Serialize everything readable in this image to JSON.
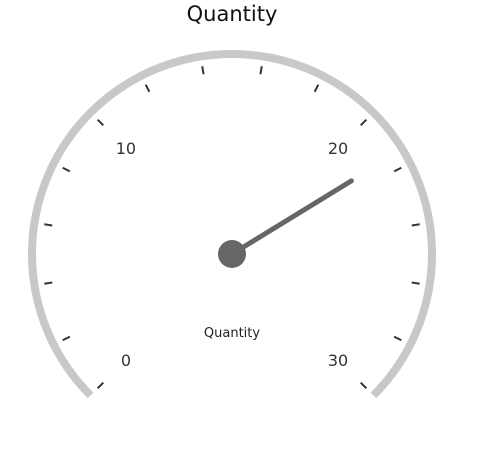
{
  "gauge": {
    "title": "Quantity",
    "caption": "Quantity",
    "min": 0,
    "max": 30,
    "value": 21.5,
    "start_angle_deg": 225,
    "end_angle_deg": -45,
    "major_step": 10,
    "minor_step": 2,
    "major_labels": [
      "0",
      "10",
      "20",
      "30"
    ],
    "colors": {
      "arc": "#c8c8c8",
      "ticks": "#333333",
      "needle": "#666666",
      "labels": "#333333"
    }
  }
}
